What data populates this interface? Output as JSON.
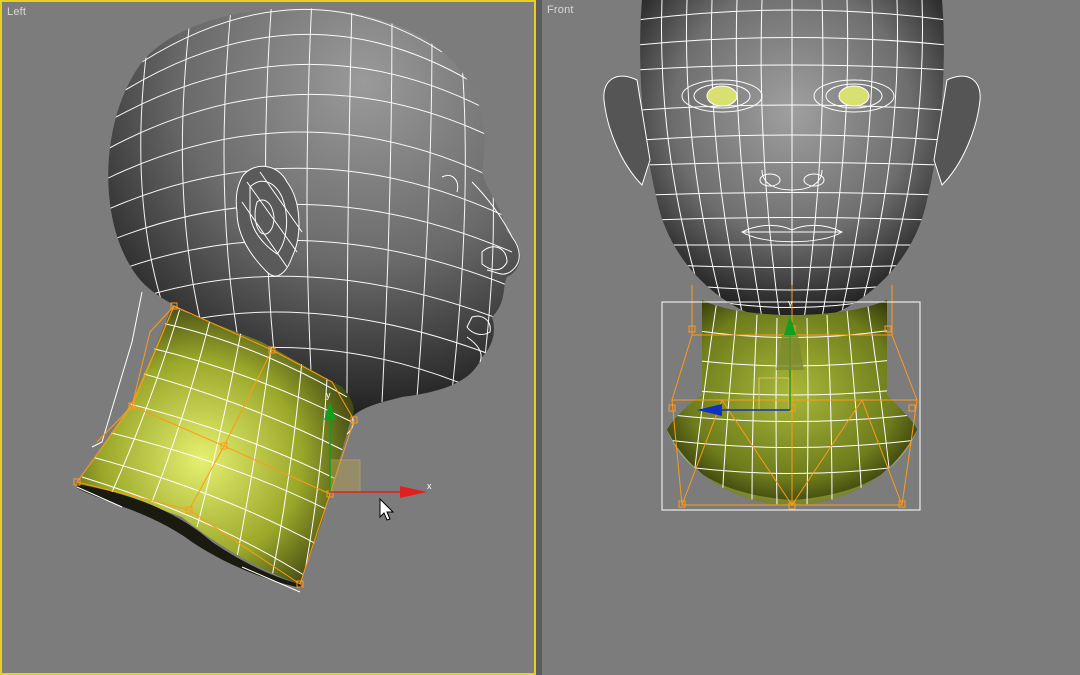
{
  "viewports": {
    "left": {
      "label": "Left",
      "active": true
    },
    "front": {
      "label": "Front",
      "active": false
    }
  },
  "gizmo": {
    "x_axis": "x",
    "y_axis": "y"
  },
  "colors": {
    "viewport_bg": "#7c7c7c",
    "active_border": "#e8d020",
    "wire": "#ffffff",
    "selection": "#b8c83a",
    "lattice": "#ff9a1a",
    "axis_x": "#e02020",
    "axis_y": "#10a020",
    "axis_z": "#1030c0"
  }
}
